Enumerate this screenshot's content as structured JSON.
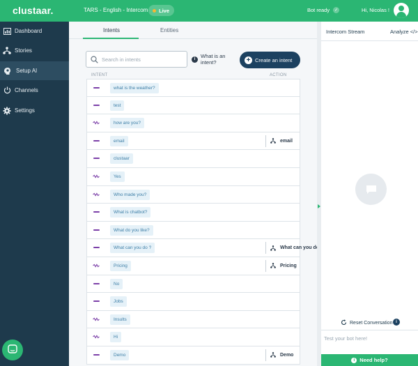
{
  "topbar": {
    "logo": "clustaar.",
    "bot_name": "TARS - English - Intercom",
    "live_label": "Live",
    "bot_status": "Bot ready",
    "greeting": "Hi, Nicolas !",
    "icons": {
      "live": "live-dot-icon",
      "status": "check-icon",
      "avatar": "user-avatar-icon"
    }
  },
  "sidebar": {
    "items": [
      {
        "label": "Dashboard",
        "icon": "dashboard-icon"
      },
      {
        "label": "Stories",
        "icon": "stories-icon"
      },
      {
        "label": "Setup AI",
        "icon": "brain-head-icon",
        "active": true
      },
      {
        "label": "Channels",
        "icon": "power-icon"
      },
      {
        "label": "Settings",
        "icon": "gear-icon"
      }
    ],
    "chat_button_icon": "chat-bubble-icon"
  },
  "main": {
    "tabs": [
      {
        "label": "Intents",
        "active": true
      },
      {
        "label": "Entities",
        "active": false
      }
    ],
    "search": {
      "placeholder": "Search in intents",
      "value": ""
    },
    "help_text": "What is an intent?",
    "create_button": "Create an intent",
    "columns": {
      "intent": "INTENT",
      "action": "ACTION"
    },
    "intents": [
      {
        "label": "what is the weather?",
        "marker": "dash",
        "action": ""
      },
      {
        "label": "test",
        "marker": "dash",
        "action": ""
      },
      {
        "label": "how are you?",
        "marker": "wave",
        "action": ""
      },
      {
        "label": "email",
        "marker": "dash",
        "action": "email"
      },
      {
        "label": "clustaar",
        "marker": "dash",
        "action": ""
      },
      {
        "label": "Yes",
        "marker": "wave",
        "action": ""
      },
      {
        "label": "Who made you?",
        "marker": "wave",
        "action": ""
      },
      {
        "label": "What is chatbot?",
        "marker": "dash",
        "action": ""
      },
      {
        "label": "What do you like?",
        "marker": "dash",
        "action": ""
      },
      {
        "label": "What can you do ?",
        "marker": "dash",
        "action": "What can you do"
      },
      {
        "label": "Pricing",
        "marker": "wave",
        "action": "Pricing"
      },
      {
        "label": "No",
        "marker": "dash",
        "action": ""
      },
      {
        "label": "Jobs",
        "marker": "dash",
        "action": ""
      },
      {
        "label": "Insults",
        "marker": "wave",
        "action": ""
      },
      {
        "label": "Hi",
        "marker": "wave",
        "action": ""
      },
      {
        "label": "Demo",
        "marker": "dash",
        "action": "Demo"
      }
    ],
    "colors": {
      "marker": "#7b3fa8",
      "chip_bg": "#e5f1f8",
      "chip_text": "#3d7ea6",
      "accent": "#2bb673",
      "dark": "#1c4160"
    }
  },
  "right_panel": {
    "title": "Intercom Stream",
    "analyze_label": "Analyze </>",
    "reset_label": "Reset Conversation",
    "test_placeholder": "Test your bot here!",
    "need_help": "Need help?"
  }
}
